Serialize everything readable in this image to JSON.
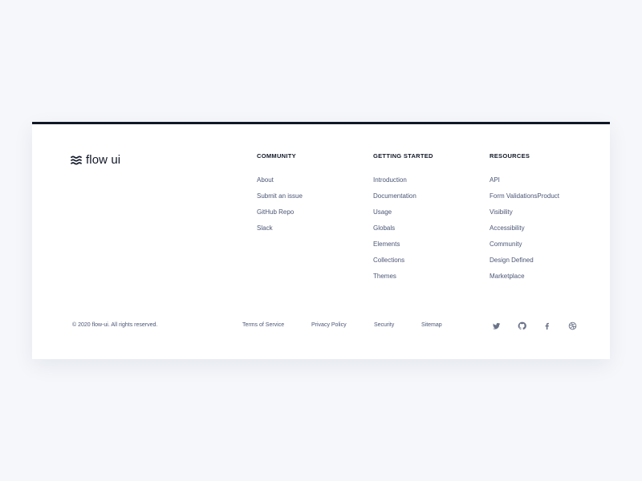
{
  "brand": {
    "name": "flow ui",
    "icon": "waves-logo-icon"
  },
  "columns": [
    {
      "title": "COMMUNITY",
      "links": [
        "About",
        "Submit an issue",
        "GitHub Repo",
        "Slack"
      ]
    },
    {
      "title": "GETTING STARTED",
      "links": [
        "Introduction",
        "Documentation",
        "Usage",
        "Globals",
        "Elements",
        "Collections",
        "Themes"
      ]
    },
    {
      "title": "RESOURCES",
      "links": [
        "API",
        "Form ValidationsProduct",
        "Visibility",
        "Accessibility",
        "Community",
        "Design Defined",
        "Marketplace"
      ]
    }
  ],
  "bottom": {
    "copyright": "© 2020 flow-ui. All rights reserved.",
    "links": [
      "Terms of Service",
      "Privacy Policy",
      "Security",
      "Sitemap"
    ]
  },
  "social": [
    {
      "icon": "twitter-icon"
    },
    {
      "icon": "github-icon"
    },
    {
      "icon": "facebook-icon"
    },
    {
      "icon": "dribbble-icon"
    }
  ],
  "colors": {
    "page_background": "#f5f7fb",
    "card_background": "#ffffff",
    "top_border": "#111827",
    "heading_text": "#111827",
    "link_text": "#4b5675",
    "icon": "#6b7389"
  }
}
